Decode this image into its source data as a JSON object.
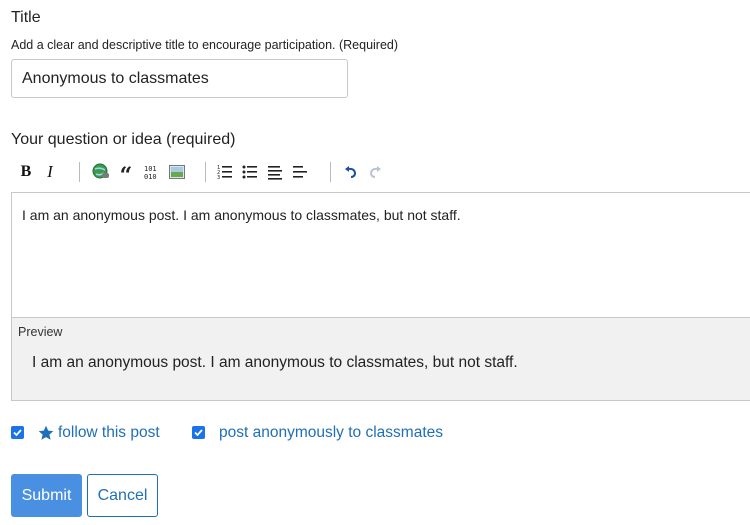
{
  "title_section": {
    "label": "Title",
    "help_text": "Add a clear and descriptive title to encourage participation. (Required)",
    "input_value": "Anonymous to classmates"
  },
  "question_section": {
    "label": "Your question or idea (required)",
    "toolbar": [
      {
        "name": "bold-icon",
        "glyph": "B"
      },
      {
        "name": "italic-icon",
        "glyph": "I"
      },
      {
        "name": "link-icon",
        "glyph": ""
      },
      {
        "name": "quote-icon",
        "glyph": "“"
      },
      {
        "name": "code-icon",
        "glyph": ""
      },
      {
        "name": "image-icon",
        "glyph": ""
      },
      {
        "name": "numbered-list-icon",
        "glyph": ""
      },
      {
        "name": "bulleted-list-icon",
        "glyph": ""
      },
      {
        "name": "heading-icon",
        "glyph": ""
      },
      {
        "name": "horizontal-rule-icon",
        "glyph": ""
      },
      {
        "name": "undo-icon",
        "glyph": ""
      },
      {
        "name": "redo-icon",
        "glyph": ""
      }
    ],
    "editor_text": "I am an anonymous post. I am anonymous to classmates, but not staff.",
    "preview_label": "Preview",
    "preview_text": "I am an anonymous post. I am anonymous to classmates, but not staff."
  },
  "options": {
    "follow_label": "follow this post",
    "follow_checked": true,
    "anonymous_label": "post anonymously to classmates",
    "anonymous_checked": true
  },
  "actions": {
    "submit_label": "Submit",
    "cancel_label": "Cancel"
  },
  "colors": {
    "accent": "#4a90e2",
    "link": "#1f6fb8",
    "checkbox": "#1a73e8"
  }
}
